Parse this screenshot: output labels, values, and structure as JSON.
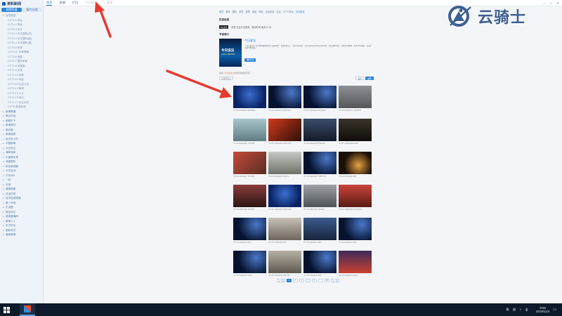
{
  "app": {
    "title": "资料新闻"
  },
  "sidebar": {
    "tabs": [
      {
        "label": "视频频道"
      },
      {
        "label": "图片分类"
      }
    ],
    "tree": [
      {
        "label": "今日说法",
        "level": 1,
        "open": true
      },
      {
        "label": "CCTV-1 综合",
        "level": 2
      },
      {
        "label": "CCTV-2 财经",
        "level": 2
      },
      {
        "label": "CCTV-3 综艺",
        "level": 2
      },
      {
        "label": "CCTV-4 中文国际(亚)",
        "level": 2
      },
      {
        "label": "CCTV-4 中文国际(欧)",
        "level": 2
      },
      {
        "label": "CCTV-4 中文国际(美)",
        "level": 2
      },
      {
        "label": "CCTV-5 体育",
        "level": 2
      },
      {
        "label": "CCTV-5+ 体育赛事",
        "level": 2
      },
      {
        "label": "CCTV-6 电影",
        "level": 2
      },
      {
        "label": "CCTV-7 国防军事",
        "level": 2
      },
      {
        "label": "CCTV-8 电视剧",
        "level": 2
      },
      {
        "label": "CCTV-9 纪录",
        "level": 2
      },
      {
        "label": "CCTV-10 科教",
        "level": 2
      },
      {
        "label": "CCTV-11 戏曲",
        "level": 2
      },
      {
        "label": "CCTV-12 社会与法",
        "level": 2
      },
      {
        "label": "CCTV-13 新闻",
        "level": 2
      },
      {
        "label": "CCTV-14 少儿",
        "level": 2
      },
      {
        "label": "CCTV-15 音乐",
        "level": 2
      },
      {
        "label": "CCTV-17 农业农村",
        "level": 2
      },
      {
        "label": "CGTN 英语新闻",
        "level": 2
      },
      {
        "label": "新闻联播",
        "level": 1
      },
      {
        "label": "焦点访谈",
        "level": 1
      },
      {
        "label": "朝闻天下",
        "level": 1
      },
      {
        "label": "新闻周刊",
        "level": 1
      },
      {
        "label": "面对面",
        "level": 1
      },
      {
        "label": "新闻调查",
        "level": 1
      },
      {
        "label": "经济半小时",
        "level": 1
      },
      {
        "label": "中国新闻",
        "level": 1
      },
      {
        "label": "今日关注",
        "level": 1
      },
      {
        "label": "海峡两岸",
        "level": 1
      },
      {
        "label": "中国舆论场",
        "level": 1
      },
      {
        "label": "深度国际",
        "level": 1
      },
      {
        "label": "防务新观察",
        "level": 1
      },
      {
        "label": "今日亚洲",
        "level": 1
      },
      {
        "label": "平安365",
        "level": 1
      },
      {
        "label": "一线",
        "level": 1
      },
      {
        "label": "天网",
        "level": 1
      },
      {
        "label": "道德观察",
        "level": 1
      },
      {
        "label": "法治在线",
        "level": 1
      },
      {
        "label": "经济信息联播",
        "level": 1
      },
      {
        "label": "第一时间",
        "level": 1
      },
      {
        "label": "生活圈",
        "level": 1
      },
      {
        "label": "财经评论",
        "level": 1
      },
      {
        "label": "新闻直播间",
        "level": 1
      },
      {
        "label": "新闻1+1",
        "level": 1
      },
      {
        "label": "东方时空",
        "level": 1
      },
      {
        "label": "国际时讯",
        "level": 1
      },
      {
        "label": "晚间新闻",
        "level": 1
      }
    ]
  },
  "topnav": {
    "links": [
      {
        "label": "首页",
        "active": true
      },
      {
        "label": "直播"
      },
      {
        "label": "栏目"
      }
    ],
    "search_placeholder": "今日说法",
    "search_icon_label": "搜索",
    "window_controls": [
      "—",
      "□",
      "✕"
    ]
  },
  "page": {
    "crumbs": [
      "首页",
      "新闻",
      "国际",
      "军事",
      "体育",
      "财经",
      "科技",
      "法治在线",
      "生活",
      "CCTV总台",
      "今日说法"
    ],
    "author_title": "栏目信息",
    "author_thumb": "今日说法",
    "author_text": "央视·社会与法频道 · 播出时间 每天12:30",
    "program_title": "节目简介",
    "program": {
      "poster_title": "今日说法",
      "poster_sub": "LEGAL REPORT",
      "name": "今日说法",
      "desc": "《今日说法》是中央电视台社会与法频道的一档法制栏目，节目以案说法，关注百姓生活中的法律问题，普及法律知识，弘扬法治精神，每天中午播出，深受广大观众的喜爱。",
      "button": "播放节目"
    },
    "summary_prefix": "频道",
    "summary_highlight": "“今日说法”",
    "summary_suffix": "共检索到视频节目",
    "filter_select": "全部节目 ▾",
    "sort": [
      {
        "label": "最新",
        "active": false
      },
      {
        "label": "最热",
        "active": true
      }
    ],
    "cards": [
      {
        "caption": "今日说法20191104 智擒嫌疑人",
        "bg": "studio"
      },
      {
        "caption": "今日说法20191103 罪恶的迷途",
        "bg": "dark"
      },
      {
        "caption": "今日说法20191102 追踪嫌疑人",
        "bg": "dark"
      },
      {
        "caption": "今日说法20191101 “雨夜”风波",
        "bg": "street"
      },
      {
        "caption": "今日说法20191031 寻找真相",
        "bg": "building"
      },
      {
        "caption": "今日说法20191030 特殊的案件",
        "bg": "ttv"
      },
      {
        "caption": "今日说法20191029 警察故事",
        "bg": "police"
      },
      {
        "caption": "今日说法20191028 惊魂夜",
        "bg": "night"
      },
      {
        "caption": "今日说法20191027 街头追踪",
        "bg": "crowd"
      },
      {
        "caption": "今日说法20191026 消失的人",
        "bg": "city"
      },
      {
        "caption": "今日说法20191025 “冒牌”女婿",
        "bg": "dark"
      },
      {
        "caption": "今日说法20191024 迷局",
        "bg": "sparks"
      },
      {
        "caption": "今日说法20191023 离奇事件",
        "bg": "woman"
      },
      {
        "caption": "今日说法20191022 错误的选择",
        "bg": "studio"
      },
      {
        "caption": "今日说法20191021 真相追击",
        "bg": "car"
      },
      {
        "caption": "今日说法20191020 意外的结局",
        "bg": "man"
      },
      {
        "caption": "今日说法20191019 谜案",
        "bg": "dark"
      },
      {
        "caption": "今日说法20191018 追寻",
        "bg": "woman2"
      },
      {
        "caption": "今日说法20191017 疑案",
        "bg": "office"
      },
      {
        "caption": "今日说法20191016 暗流",
        "bg": "dark"
      },
      {
        "caption": "今日说法20191015 “陷阱”",
        "bg": "dark"
      },
      {
        "caption": "今日说法20191014 回家之路",
        "bg": "room"
      },
      {
        "caption": "今日说法20191013 隐情",
        "bg": "dark"
      },
      {
        "caption": "今日说法20191012 夜幕下",
        "bg": "nightstreet"
      }
    ],
    "pager": [
      {
        "label": "上一页"
      },
      {
        "label": "1",
        "active": true
      },
      {
        "label": "2"
      },
      {
        "label": "3"
      },
      {
        "label": "4"
      },
      {
        "label": "5"
      },
      {
        "label": "…"
      },
      {
        "label": "99"
      },
      {
        "label": "下一页"
      }
    ]
  },
  "watermark": {
    "text": "云骑士"
  },
  "taskbar": {
    "tray_icons": [
      "⊞",
      "中",
      "♪",
      "令"
    ],
    "time": "8:55",
    "date": "2019/11/4",
    "notify": "▭"
  },
  "colors": {
    "accent": "#2f86d8",
    "arrow": "#e8392e",
    "taskbar": "#0d1a2b"
  }
}
